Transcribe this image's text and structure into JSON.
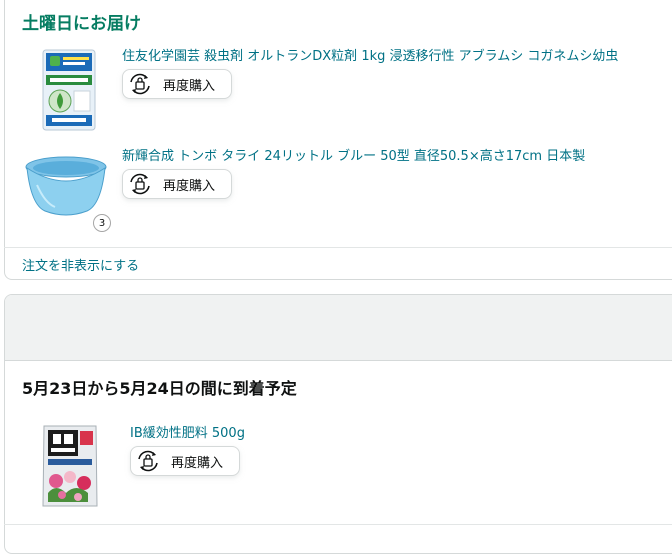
{
  "order1": {
    "delivery_title": "土曜日にお届け",
    "items": [
      {
        "title": "住友化学園芸 殺虫剤 オルトランDX粒剤 1kg 浸透移行性 アブラムシ コガネムシ幼虫",
        "buy_again": "再度購入"
      },
      {
        "title": "新輝合成 トンボ タライ 24リットル ブルー 50型 直径50.5×高さ17cm 日本製",
        "buy_again": "再度購入",
        "quantity": "3"
      }
    ],
    "hide_order": "注文を非表示にする"
  },
  "order2": {
    "delivery_title": "5月23日から5月24日の間に到着予定",
    "items": [
      {
        "title": "IB緩効性肥料 500g",
        "buy_again": "再度購入"
      }
    ]
  },
  "colors": {
    "link": "#007185",
    "delivery_green": "#067d62",
    "border": "#d5d9d9"
  },
  "icons": {
    "buy_again": "reorder-bag-icon"
  }
}
